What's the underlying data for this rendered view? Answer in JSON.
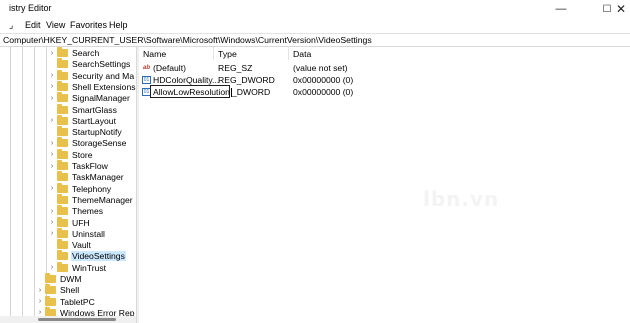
{
  "window": {
    "title": "istry Editor",
    "minimize": "—",
    "maximize": "☐",
    "close": "✕"
  },
  "menu": {
    "file": "⌟",
    "edit": "Edit",
    "view": "View",
    "favorites": "Favorites",
    "help": "Help"
  },
  "address": "Computer\\HKEY_CURRENT_USER\\Software\\Microsoft\\Windows\\CurrentVersion\\VideoSettings",
  "tree": {
    "items": [
      {
        "label": "Search",
        "expandable": true,
        "level": 2,
        "selected": false
      },
      {
        "label": "SearchSettings",
        "expandable": false,
        "level": 2,
        "selected": false
      },
      {
        "label": "Security and Ma",
        "expandable": true,
        "level": 2,
        "selected": false
      },
      {
        "label": "Shell Extensions",
        "expandable": true,
        "level": 2,
        "selected": false
      },
      {
        "label": "SignalManager",
        "expandable": true,
        "level": 2,
        "selected": false
      },
      {
        "label": "SmartGlass",
        "expandable": false,
        "level": 2,
        "selected": false
      },
      {
        "label": "StartLayout",
        "expandable": true,
        "level": 2,
        "selected": false
      },
      {
        "label": "StartupNotify",
        "expandable": false,
        "level": 2,
        "selected": false
      },
      {
        "label": "StorageSense",
        "expandable": true,
        "level": 2,
        "selected": false
      },
      {
        "label": "Store",
        "expandable": true,
        "level": 2,
        "selected": false
      },
      {
        "label": "TaskFlow",
        "expandable": true,
        "level": 2,
        "selected": false
      },
      {
        "label": "TaskManager",
        "expandable": false,
        "level": 2,
        "selected": false
      },
      {
        "label": "Telephony",
        "expandable": true,
        "level": 2,
        "selected": false
      },
      {
        "label": "ThemeManager",
        "expandable": false,
        "level": 2,
        "selected": false
      },
      {
        "label": "Themes",
        "expandable": true,
        "level": 2,
        "selected": false
      },
      {
        "label": "UFH",
        "expandable": true,
        "level": 2,
        "selected": false
      },
      {
        "label": "Uninstall",
        "expandable": true,
        "level": 2,
        "selected": false
      },
      {
        "label": "Vault",
        "expandable": false,
        "level": 2,
        "selected": false
      },
      {
        "label": "VideoSettings",
        "expandable": false,
        "level": 2,
        "selected": true
      },
      {
        "label": "WinTrust",
        "expandable": true,
        "level": 2,
        "selected": false
      },
      {
        "label": "DWM",
        "expandable": false,
        "level": 1,
        "selected": false
      },
      {
        "label": "Shell",
        "expandable": true,
        "level": 1,
        "selected": false
      },
      {
        "label": "TabletPC",
        "expandable": true,
        "level": 1,
        "selected": false
      },
      {
        "label": "Windows Error Rep",
        "expandable": true,
        "level": 1,
        "selected": false
      }
    ]
  },
  "list": {
    "columns": {
      "name": "Name",
      "type": "Type",
      "data": "Data"
    },
    "rows": [
      {
        "icon": "ab",
        "name": "(Default)",
        "type": "REG_SZ",
        "data": "(value not set)"
      },
      {
        "icon": "bin",
        "name": "HDColorQuality...",
        "type": "REG_DWORD",
        "data": "0x00000000 (0)"
      },
      {
        "icon": "bin",
        "name": "AllowLowResolution",
        "type": "_DWORD",
        "data": "0x00000000 (0)",
        "editing": true
      }
    ]
  },
  "watermark": "lbn.vn"
}
